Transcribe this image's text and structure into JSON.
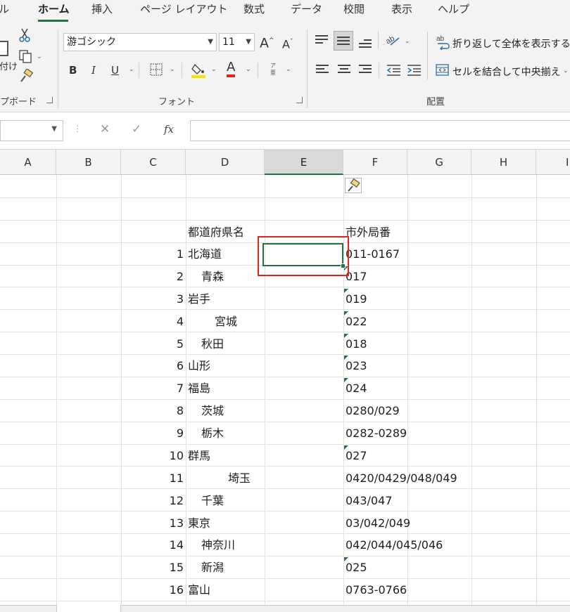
{
  "ribbon": {
    "tabs": [
      {
        "label": "ル",
        "active": false
      },
      {
        "label": "ホーム",
        "active": true
      },
      {
        "label": "挿入",
        "active": false
      },
      {
        "label": "ページ レイアウト",
        "active": false
      },
      {
        "label": "数式",
        "active": false
      },
      {
        "label": "データ",
        "active": false
      },
      {
        "label": "校閲",
        "active": false
      },
      {
        "label": "表示",
        "active": false
      },
      {
        "label": "ヘルプ",
        "active": false
      }
    ],
    "clipboard": {
      "group_label": "プボード",
      "paste_partial": "付け"
    },
    "font": {
      "group_label": "フォント",
      "font_name": "游ゴシック",
      "font_size": "11",
      "grow_label": "A",
      "shrink_label": "A",
      "bold_label": "B",
      "italic_label": "I",
      "underline_label": "U",
      "font_color_label": "A",
      "phonetic_label": "ア亜"
    },
    "alignment": {
      "group_label": "配置",
      "wrap_text_label": "折り返して全体を表示する",
      "merge_center_label": "セルを結合して中央揃え"
    }
  },
  "formula_bar": {
    "cancel_label": "✕",
    "enter_label": "✓",
    "fx_label": "fx",
    "value": ""
  },
  "grid": {
    "columns": [
      "A",
      "B",
      "C",
      "D",
      "E",
      "F",
      "G",
      "H",
      "I"
    ],
    "selected_column": "E",
    "header_row": {
      "prefecture_header": "都道府県名",
      "code_header": "市外局番"
    },
    "rows": [
      {
        "no": "1",
        "pref": "北海道",
        "indent": 0,
        "code": "011-0167",
        "flag": false
      },
      {
        "no": "2",
        "pref": "青森",
        "indent": 1,
        "code": "017",
        "flag": true
      },
      {
        "no": "3",
        "pref": "岩手",
        "indent": 0,
        "code": "019",
        "flag": true
      },
      {
        "no": "4",
        "pref": "宮城",
        "indent": 2,
        "code": "022",
        "flag": true
      },
      {
        "no": "5",
        "pref": "秋田",
        "indent": 1,
        "code": "018",
        "flag": true
      },
      {
        "no": "6",
        "pref": "山形",
        "indent": 0,
        "code": "023",
        "flag": true
      },
      {
        "no": "7",
        "pref": "福島",
        "indent": 0,
        "code": "024",
        "flag": true
      },
      {
        "no": "8",
        "pref": "茨城",
        "indent": 1,
        "code": "0280/029",
        "flag": false
      },
      {
        "no": "9",
        "pref": "栃木",
        "indent": 1,
        "code": "0282-0289",
        "flag": false
      },
      {
        "no": "10",
        "pref": "群馬",
        "indent": 0,
        "code": "027",
        "flag": true
      },
      {
        "no": "11",
        "pref": "埼玉",
        "indent": 3,
        "code": "0420/0429/048/049",
        "flag": false
      },
      {
        "no": "12",
        "pref": "千葉",
        "indent": 1,
        "code": "043/047",
        "flag": false
      },
      {
        "no": "13",
        "pref": "東京",
        "indent": 0,
        "code": "03/042/049",
        "flag": false
      },
      {
        "no": "14",
        "pref": "神奈川",
        "indent": 1,
        "code": "042/044/045/046",
        "flag": false
      },
      {
        "no": "15",
        "pref": "新潟",
        "indent": 1,
        "code": "025",
        "flag": true
      },
      {
        "no": "16",
        "pref": "富山",
        "indent": 0,
        "code": "0763-0766",
        "flag": false
      }
    ]
  },
  "colors": {
    "accent": "#217346",
    "highlight": "#e3261d",
    "error_flag": "#1a7a3c"
  }
}
